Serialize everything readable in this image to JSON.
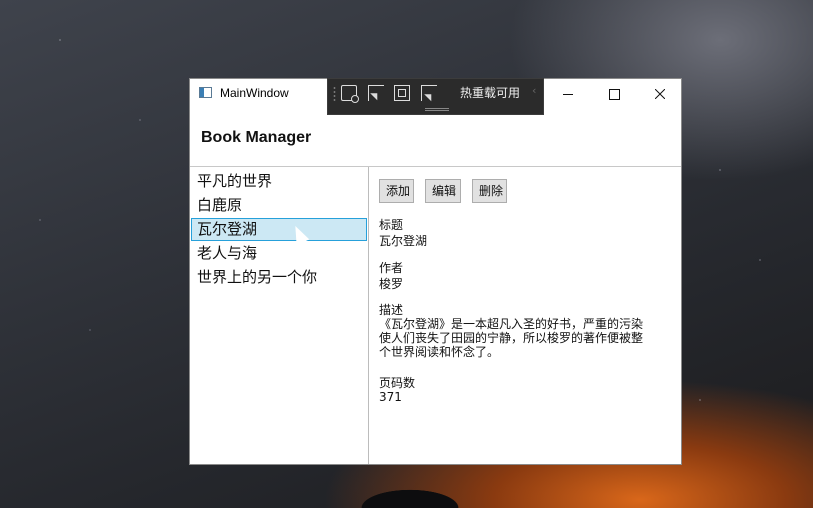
{
  "window": {
    "title": "MainWindow"
  },
  "toolbar": {
    "label": "热重载可用"
  },
  "header": {
    "title": "Book Manager"
  },
  "books": [
    {
      "title": "平凡的世界"
    },
    {
      "title": "白鹿原"
    },
    {
      "title": "瓦尔登湖",
      "selected": true
    },
    {
      "title": "老人与海"
    },
    {
      "title": "世界上的另一个你"
    }
  ],
  "actions": {
    "add": "添加",
    "edit": "编辑",
    "delete": "删除"
  },
  "detail": {
    "title_label": "标题",
    "title_value": "瓦尔登湖",
    "author_label": "作者",
    "author_value": "梭罗",
    "description_label": "描述",
    "description_value": "《瓦尔登湖》是一本超凡入圣的好书，严重的污染使人们丧失了田园的宁静，所以梭罗的著作便被整个世界阅读和怀念了。",
    "pages_label": "页码数",
    "pages_value": "371"
  }
}
